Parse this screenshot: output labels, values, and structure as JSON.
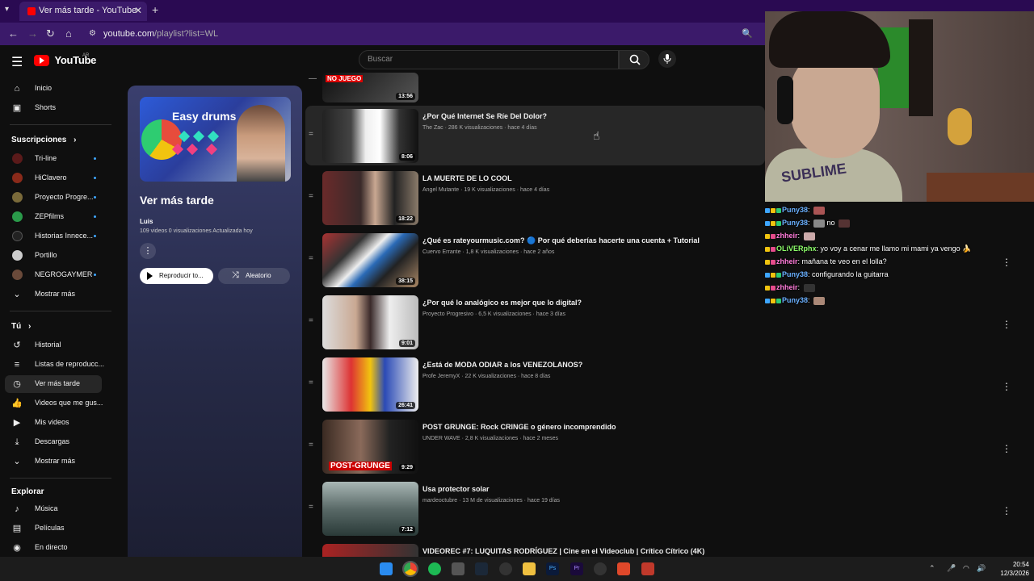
{
  "browser": {
    "tab_title": "Ver más tarde - YouTube",
    "tab_close": "✕",
    "new_tab": "+",
    "url_main": "youtube.com",
    "url_rest": "/playlist?list=WL"
  },
  "header": {
    "logo_text": "YouTube",
    "country_code": "AR",
    "search_placeholder": "Buscar"
  },
  "sidebar": {
    "main": [
      {
        "label": "Inicio",
        "icon": "home-icon"
      },
      {
        "label": "Shorts",
        "icon": "shorts-icon"
      }
    ],
    "subs_title": "Suscripciones",
    "subs": [
      {
        "label": "Tri-line"
      },
      {
        "label": "HiClavero"
      },
      {
        "label": "Proyecto Progre..."
      },
      {
        "label": "ZEPfilms"
      },
      {
        "label": "Historias Innece..."
      },
      {
        "label": "Portillo"
      },
      {
        "label": "NEGROGAYMER"
      }
    ],
    "show_more": "Mostrar más",
    "you_title": "Tú",
    "you": [
      {
        "label": "Historial"
      },
      {
        "label": "Listas de reproducc..."
      },
      {
        "label": "Ver más tarde"
      },
      {
        "label": "Videos que me gus..."
      },
      {
        "label": "Mis videos"
      },
      {
        "label": "Descargas"
      }
    ],
    "show_more2": "Mostrar más",
    "explore_title": "Explorar",
    "explore": [
      {
        "label": "Música"
      },
      {
        "label": "Películas"
      },
      {
        "label": "En directo"
      }
    ]
  },
  "playlist": {
    "thumb_text": "Easy drums",
    "title": "Ver más tarde",
    "owner": "Luis",
    "meta": "109 videos   0 visualizaciones   Actualizada hoy",
    "more": "⋮",
    "play_all": "Reproducir to...",
    "shuffle": "Aleatorio"
  },
  "videos": [
    {
      "title": "",
      "meta": "",
      "duration": "13:56",
      "thumb_text": "NO JUEGO"
    },
    {
      "title": "¿Por Qué Internet Se Ríe Del Dolor?",
      "meta": "The Zac · 286 K visualizaciones · hace 4 días",
      "duration": "8:06"
    },
    {
      "title": "LA MUERTE DE LO COOL",
      "meta": "Angel Mutante · 19 K visualizaciones · hace 4 días",
      "duration": "18:22"
    },
    {
      "title": "¿Qué es rateyourmusic.com? 🔵 Por qué deberías hacerte una cuenta + Tutorial",
      "meta": "Cuervo Errante · 1,8 K visualizaciones · hace 2 años",
      "duration": "38:15"
    },
    {
      "title": "¿Por qué lo analógico es mejor que lo digital?",
      "meta": "Proyecto Progresivo · 6,5 K visualizaciones · hace 3 días",
      "duration": "9:01"
    },
    {
      "title": "¿Está de MODA ODIAR a los VENEZOLANOS?",
      "meta": "Profe JeremyX · 22 K visualizaciones · hace 8 días",
      "duration": "26:41"
    },
    {
      "title": "POST GRUNGE: Rock CRINGE o género incomprendido",
      "meta": "UNDER WAVE · 2,8 K visualizaciones · hace 2 meses",
      "duration": "9:29",
      "thumb_text": "POST-GRUNGE"
    },
    {
      "title": "Usa protector solar",
      "meta": "mardeoctubre · 13 M de visualizaciones · hace 19 días",
      "duration": "7:12"
    },
    {
      "title": "VIDEOREC #7: LUQUITAS RODRÍGUEZ | Cine en el Videoclub | Crítico Cítrico (4K)",
      "meta": "",
      "duration": ""
    }
  ],
  "chat": [
    {
      "user": "Puny38",
      "msg": ""
    },
    {
      "user": "Puny38",
      "msg": "no"
    },
    {
      "user": "zhheir",
      "msg": ""
    },
    {
      "user": "OLiVERphx",
      "msg": "yo voy a cenar me llamo mi mami ya vengo 🍌"
    },
    {
      "user": "zhheir",
      "msg": "mañana te veo en el lolla?"
    },
    {
      "user": "Puny38",
      "msg": "configurando la guitarra"
    },
    {
      "user": "zhheir",
      "msg": ""
    },
    {
      "user": "Puny38",
      "msg": ""
    }
  ],
  "webcam": {
    "shirt_text": "SUBLIME"
  },
  "taskbar": {
    "time": "20:54",
    "date": "12/3/2026"
  },
  "colors": {
    "accent": "#ff0000",
    "chrome": "#3b1a6a",
    "bg": "#0f0f0f"
  }
}
